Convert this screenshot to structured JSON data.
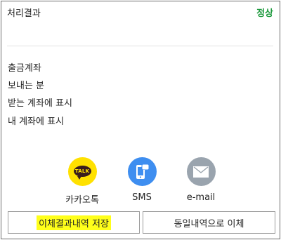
{
  "result": {
    "label": "처리결과",
    "status": "정상"
  },
  "fields": {
    "withdrawal_account": "출금계좌",
    "sender": "보내는 분",
    "recipient_display": "받는 계좌에 표시",
    "my_display": "내 계좌에 표시"
  },
  "share": {
    "kakao": {
      "label": "카카오톡",
      "icon_text": "TALK",
      "icon": "kakaotalk-icon"
    },
    "sms": {
      "label": "SMS",
      "icon": "sms-icon"
    },
    "email": {
      "label": "e-mail",
      "icon": "envelope-icon"
    }
  },
  "buttons": {
    "save": "이체결과내역 저장",
    "repeat": "동일내역으로 이체"
  },
  "colors": {
    "status_green": "#1e9a3e",
    "kakao_yellow": "#ffe100",
    "sms_blue": "#3e8ef0",
    "mail_gray": "#9aa4ae",
    "highlight": "#ffff1a"
  }
}
